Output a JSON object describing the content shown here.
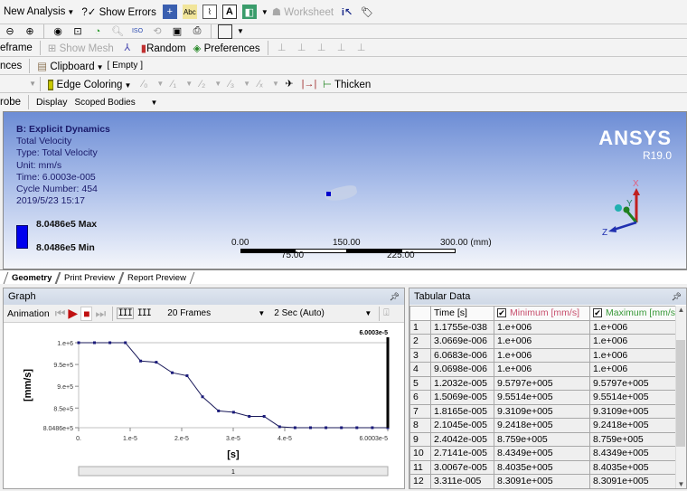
{
  "toolbar1": {
    "new_analysis": "New Analysis",
    "show_errors": "Show Errors",
    "worksheet": "Worksheet"
  },
  "toolbar3": {
    "wireframe": "eframe",
    "show_mesh": "Show Mesh",
    "random": "Random",
    "preferences": "Preferences"
  },
  "toolbar4": {
    "left_cut": "nces",
    "clipboard": "Clipboard",
    "clipboard_value": "[ Empty ]"
  },
  "toolbar5": {
    "edge_coloring": "Edge Coloring",
    "thicken": "Thicken"
  },
  "toolbar6": {
    "probe": "robe",
    "display_label": "Display",
    "display_value": "Scoped Bodies"
  },
  "viewport": {
    "title": "B: Explicit Dynamics",
    "result_name": "Total Velocity",
    "type": "Type: Total Velocity",
    "unit": "Unit: mm/s",
    "time": "Time: 6.0003e-005",
    "cycle": "Cycle Number: 454",
    "datetime": "2019/5/23 15:17",
    "legend_max": "8.0486e5 Max",
    "legend_min": "8.0486e5 Min",
    "legend_color": "#0000ee",
    "logo": "ANSYS",
    "version": "R19.0",
    "scale_labels_top": [
      "0.00",
      "150.00",
      "300.00 (mm)"
    ],
    "scale_labels_bottom": [
      "75.00",
      "225.00"
    ],
    "triad": {
      "x": "X",
      "y": "Y",
      "z": "Z"
    }
  },
  "view_tabs": [
    "Geometry",
    "Print Preview",
    "Report Preview"
  ],
  "graph": {
    "title": "Graph",
    "animation_label": "Animation",
    "frames": "20 Frames",
    "duration": "2 Sec (Auto)",
    "slider_value": "1"
  },
  "chart_data": {
    "type": "line",
    "xlabel": "[s]",
    "ylabel": "[mm/s]",
    "xlim": [
      0,
      6.0003e-05
    ],
    "ylim": [
      804860,
      1000000
    ],
    "xticks": [
      0,
      1e-05,
      2e-05,
      3e-05,
      4e-05,
      6.0003e-05
    ],
    "xtick_labels": [
      "0.",
      "1.e-5",
      "2.e-5",
      "3.e-5",
      "4.e-5",
      "6.0003e-5"
    ],
    "yticks": [
      804860,
      850000,
      900000,
      950000,
      1000000
    ],
    "ytick_labels": [
      "8.0486e+5",
      "8.5e+5",
      "9.e+5",
      "9.5e+5",
      "1.e+6"
    ],
    "cursor_label": "6.0003e-5",
    "series": [
      {
        "name": "Total Velocity",
        "x": [
          0,
          3.0669e-06,
          6.0683e-06,
          9.0698e-06,
          1.2032e-05,
          1.5069e-05,
          1.8165e-05,
          2.1045e-05,
          2.4042e-05,
          2.7141e-05,
          3.0067e-05,
          3.311e-05,
          3.6e-05,
          3.9e-05,
          4.2e-05,
          4.5e-05,
          4.8e-05,
          5.1e-05,
          5.4e-05,
          5.7e-05,
          6.0003e-05
        ],
        "y": [
          1000000,
          1000000,
          1000000,
          1000000,
          957970,
          955140,
          931090,
          924180,
          875900,
          843490,
          840350,
          830910,
          830910,
          807000,
          804860,
          804860,
          804860,
          804860,
          804860,
          804860,
          804860
        ]
      }
    ]
  },
  "tabular": {
    "title": "Tabular Data",
    "columns": [
      "",
      "Time [s]",
      "Minimum [mm/s]",
      "Maximum [mm/s]"
    ],
    "min_color": "#c8506e",
    "max_color": "#3a9a3a",
    "rows": [
      [
        "1",
        "1.1755e-038",
        "1.e+006",
        "1.e+006"
      ],
      [
        "2",
        "3.0669e-006",
        "1.e+006",
        "1.e+006"
      ],
      [
        "3",
        "6.0683e-006",
        "1.e+006",
        "1.e+006"
      ],
      [
        "4",
        "9.0698e-006",
        "1.e+006",
        "1.e+006"
      ],
      [
        "5",
        "1.2032e-005",
        "9.5797e+005",
        "9.5797e+005"
      ],
      [
        "6",
        "1.5069e-005",
        "9.5514e+005",
        "9.5514e+005"
      ],
      [
        "7",
        "1.8165e-005",
        "9.3109e+005",
        "9.3109e+005"
      ],
      [
        "8",
        "2.1045e-005",
        "9.2418e+005",
        "9.2418e+005"
      ],
      [
        "9",
        "2.4042e-005",
        "8.759e+005",
        "8.759e+005"
      ],
      [
        "10",
        "2.7141e-005",
        "8.4349e+005",
        "8.4349e+005"
      ],
      [
        "11",
        "3.0067e-005",
        "8.4035e+005",
        "8.4035e+005"
      ],
      [
        "12",
        "3.311e-005",
        "8.3091e+005",
        "8.3091e+005"
      ]
    ]
  }
}
